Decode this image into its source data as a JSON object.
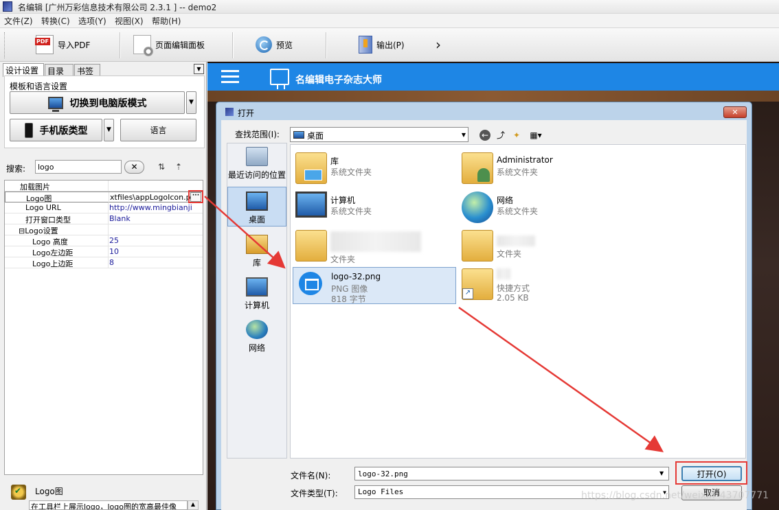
{
  "window": {
    "title": "名编辑 [广州万彩信息技术有限公司 2.3.1 ] -- demo2"
  },
  "menu": [
    "文件(Z)",
    "转换(C)",
    "选项(Y)",
    "视图(X)",
    "帮助(H)"
  ],
  "toolbar": {
    "import_pdf": "导入PDF",
    "page_editor": "页面编辑面板",
    "preview": "预览",
    "output": "输出(P)",
    "more_icon": "chevron-right-icon"
  },
  "left_panel": {
    "tabs": [
      "设计设置",
      "目录",
      "书签"
    ],
    "group_label": "模板和语言设置",
    "switch_mode": "切换到电脑版模式",
    "mobile_type": "手机版类型",
    "language": "语言",
    "search_label": "搜索:",
    "search_value": "logo",
    "properties": [
      {
        "key": "加载图片",
        "value": ""
      },
      {
        "key": "Logo图",
        "value": "xtfiles\\appLogoIcon.png"
      },
      {
        "key": "Logo URL",
        "value": "http://www.mingbianji.com"
      },
      {
        "key": "打开窗口类型",
        "value": "Blank"
      },
      {
        "key": "⊟Logo设置",
        "value": ""
      },
      {
        "key": "Logo 高度",
        "value": "25"
      },
      {
        "key": "Logo左边距",
        "value": "10"
      },
      {
        "key": "Logo上边距",
        "value": "8"
      }
    ],
    "ellipsis": "···",
    "description_title": "Logo图",
    "description_text": "在工具栏上展示logo，logo图的宽高最佳像"
  },
  "preview_app": {
    "brand": "名编辑电子杂志大师",
    "accent": "#1e86e5"
  },
  "dialog": {
    "title": "打开",
    "close": "✕",
    "look_in_label": "查找范围(I):",
    "look_in_value": "桌面",
    "places": [
      "最近访问的位置",
      "桌面",
      "库",
      "计算机",
      "网络"
    ],
    "files": [
      {
        "name": "库",
        "type": "系统文件夹",
        "size": "",
        "icon": "library-folder-icon"
      },
      {
        "name": "Administrator",
        "type": "系统文件夹",
        "size": "",
        "icon": "user-folder-icon"
      },
      {
        "name": "计算机",
        "type": "系统文件夹",
        "size": "",
        "icon": "computer-icon"
      },
      {
        "name": "网络",
        "type": "系统文件夹",
        "size": "",
        "icon": "network-icon"
      },
      {
        "name": "",
        "type": "文件夹",
        "size": "",
        "icon": "folder-icon"
      },
      {
        "name": "",
        "type": "文件夹",
        "size": "",
        "icon": "folder-icon"
      },
      {
        "name": "logo-32.png",
        "type": "PNG 图像",
        "size": "818 字节",
        "icon": "png-file-icon"
      },
      {
        "name": "",
        "type": "快捷方式",
        "size": "2.05 KB",
        "icon": "shortcut-icon"
      }
    ],
    "filename_label": "文件名(N):",
    "filename_value": "logo-32.png",
    "filetype_label": "文件类型(T):",
    "filetype_value": "Logo Files",
    "open_button": "打开(O)",
    "cancel_button": "取消"
  },
  "watermark": "https://blog.csdn.net/weixin_43707771",
  "colors": {
    "highlight": "#e53935",
    "selection": "#dbe8f7"
  }
}
